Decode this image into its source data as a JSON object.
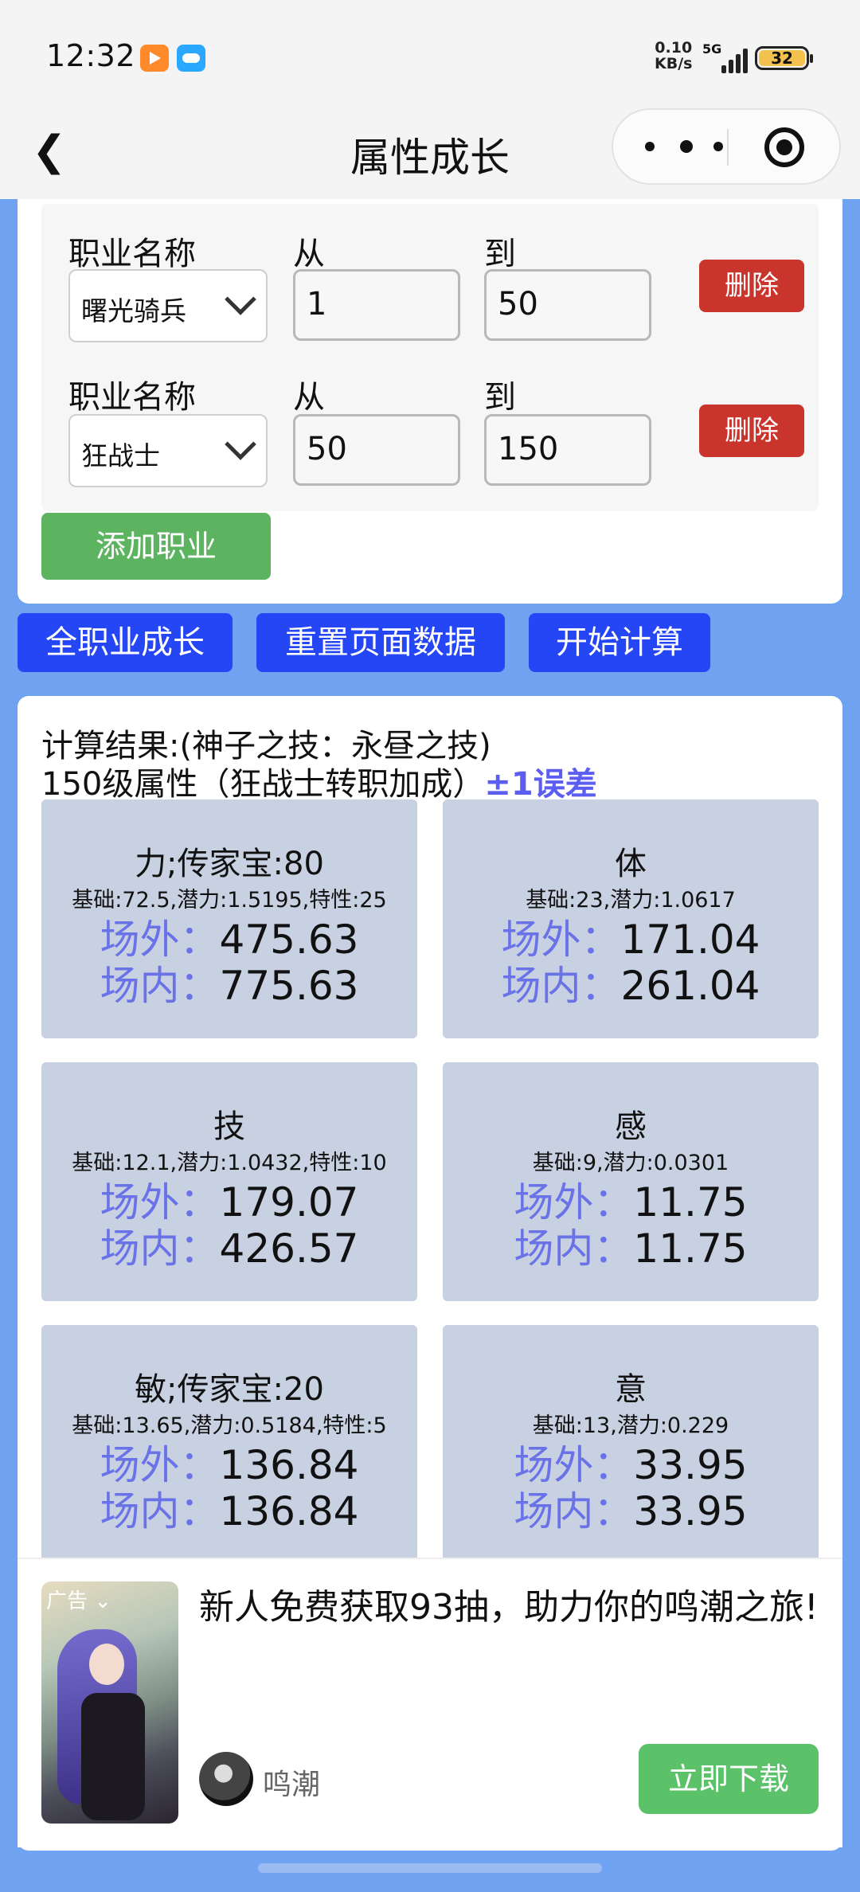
{
  "status_bar": {
    "time": "12:32",
    "net_speed_value": "0.10",
    "net_speed_unit": "KB/s",
    "network": "5G",
    "battery": "32"
  },
  "nav": {
    "title": "属性成长",
    "back_icon": "chevron-left-icon",
    "more_icon": "more-dots-icon",
    "record_icon": "record-target-icon"
  },
  "form": {
    "rows": [
      {
        "class_label": "职业名称",
        "class_value": "曙光骑兵",
        "from_label": "从",
        "from_value": "1",
        "to_label": "到",
        "to_value": "50",
        "delete_label": "删除"
      },
      {
        "class_label": "职业名称",
        "class_value": "狂战士",
        "from_label": "从",
        "from_value": "50",
        "to_label": "到",
        "to_value": "150",
        "delete_label": "删除"
      }
    ],
    "add_label": "添加职业"
  },
  "actions": {
    "all_growth": "全职业成长",
    "reset": "重置页面数据",
    "calculate": "开始计算"
  },
  "result": {
    "line1": "计算结果:(神子之技：永昼之技)",
    "line2": "150级属性（狂战士转职加成）",
    "error_note": "±1误差",
    "out_label": "场外：",
    "in_label": "场内：",
    "stats": [
      {
        "title": "力;传家宝:80",
        "base": "基础:72.5,潜力:1.5195,特性:25",
        "out": "475.63",
        "in": "775.63"
      },
      {
        "title": "体",
        "base": "基础:23,潜力:1.0617",
        "out": "171.04",
        "in": "261.04"
      },
      {
        "title": "技",
        "base": "基础:12.1,潜力:1.0432,特性:10",
        "out": "179.07",
        "in": "426.57"
      },
      {
        "title": "感",
        "base": "基础:9,潜力:0.0301",
        "out": "11.75",
        "in": "11.75"
      },
      {
        "title": "敏;传家宝:20",
        "base": "基础:13.65,潜力:0.5184,特性:5",
        "out": "136.84",
        "in": "136.84"
      },
      {
        "title": "意",
        "base": "基础:13,潜力:0.229",
        "out": "33.95",
        "in": "33.95"
      }
    ]
  },
  "ad": {
    "tag": "广告",
    "title": "新人免费获取93抽，助力你的鸣潮之旅!",
    "advertiser": "鸣潮",
    "cta": "立即下载"
  },
  "colors": {
    "page_bg": "#6fa3f2",
    "primary_blue": "#2446f5",
    "delete_red": "#c9352d",
    "add_green": "#5cb360",
    "stat_card": "#c8d1e2",
    "label_purple": "#6a72e8"
  }
}
